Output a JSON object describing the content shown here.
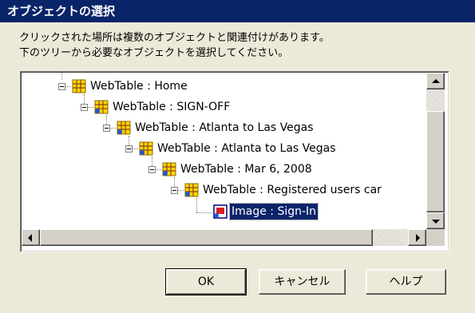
{
  "dialog": {
    "title": "オブジェクトの選択",
    "instruction_line1": "クリックされた場所は複数のオブジェクトと関連付けがあります。",
    "instruction_line2": "下のツリーから必要なオブジェクトを選択してください。"
  },
  "tree": {
    "nodes": [
      {
        "label": "WebTable : Home",
        "icon": "webtable-icon",
        "expanded": true
      },
      {
        "label": "WebTable : SIGN-OFF",
        "icon": "webtable-icon",
        "expanded": true
      },
      {
        "label": "WebTable : Atlanta to Las Vegas",
        "icon": "webtable-icon",
        "expanded": true
      },
      {
        "label": "WebTable : Atlanta to Las Vegas",
        "icon": "webtable-icon",
        "expanded": true
      },
      {
        "label": "WebTable : Mar 6, 2008",
        "icon": "webtable-icon",
        "expanded": true
      },
      {
        "label": "WebTable : Registered users car",
        "icon": "webtable-icon",
        "expanded": true
      },
      {
        "label": "Image : Sign-In",
        "icon": "image-icon",
        "selected": true
      }
    ]
  },
  "buttons": {
    "ok": "OK",
    "cancel": "キャンセル",
    "help": "ヘルプ"
  },
  "colors": {
    "title_bar": "#0a246a",
    "selection": "#0a246a",
    "face": "#ece9d8"
  }
}
